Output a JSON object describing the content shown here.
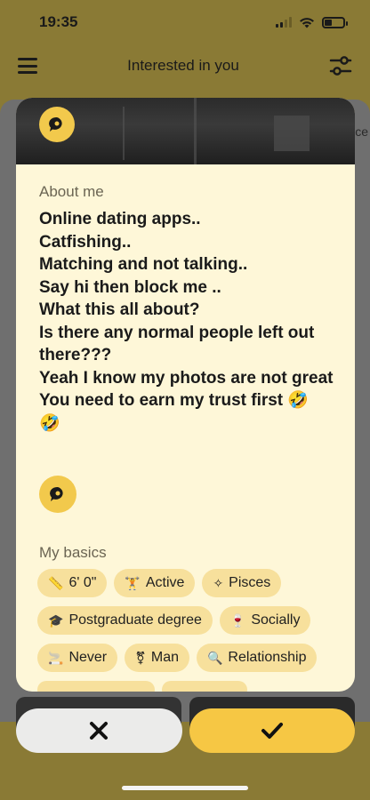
{
  "status": {
    "time": "19:35"
  },
  "header": {
    "title": "Interested in you"
  },
  "background_card": {
    "peek_text": "ce"
  },
  "photo": {
    "caption": ""
  },
  "about": {
    "label": "About me",
    "text": "Online dating apps..\nCatfishing..\nMatching and not talking..\nSay hi then block me ..\nWhat this all about?\nIs there any normal people left out there???\nYeah I know my photos are not great\nYou need to earn my trust first 🤣\n🤣"
  },
  "basics": {
    "label": "My basics",
    "chips": [
      {
        "icon": "ruler-icon",
        "glyph": "📏",
        "label": "6' 0\""
      },
      {
        "icon": "dumbbell-icon",
        "glyph": "🏋",
        "label": "Active"
      },
      {
        "icon": "zodiac-icon",
        "glyph": "✧",
        "label": "Pisces"
      },
      {
        "icon": "graduation-cap-icon",
        "glyph": "🎓",
        "label": "Postgraduate degree"
      },
      {
        "icon": "wine-glass-icon",
        "glyph": "🍷",
        "label": "Socially"
      },
      {
        "icon": "smoking-icon",
        "glyph": "🚬",
        "label": "Never"
      },
      {
        "icon": "gender-icon",
        "glyph": "⚧",
        "label": "Man"
      },
      {
        "icon": "search-icon",
        "glyph": "🔍",
        "label": "Relationship"
      }
    ]
  },
  "actions": {
    "pass_icon": "close-icon",
    "like_icon": "check-icon"
  },
  "colors": {
    "accent": "#f6c744",
    "card_bg": "#fef7d8",
    "chip_bg": "#f7e09c"
  }
}
